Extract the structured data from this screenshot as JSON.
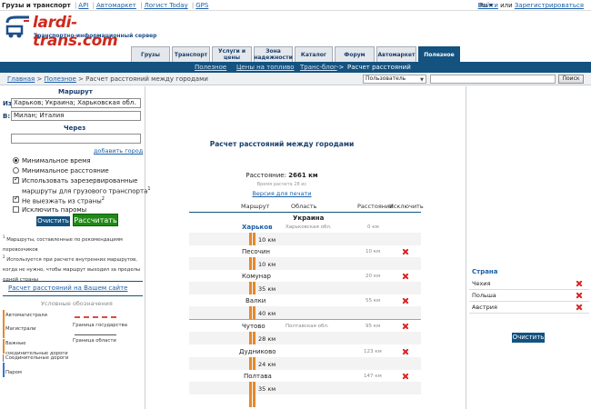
{
  "topbar": {
    "site_name": "Грузы и транспорт",
    "links": [
      "API",
      "Автомаркет",
      "Логист Today",
      "GPS"
    ],
    "lang": "Ru",
    "login": "Войти",
    "or": "или",
    "register": "Зарегистрироваться"
  },
  "logo": {
    "name": "lardi-trans.com",
    "tagline": "Транспортно-информационный сервер"
  },
  "tabs": [
    "Грузы",
    "Транспорт",
    "Услуги и цены",
    "Зона надежности",
    "Каталог",
    "Форум",
    "Автомаркет",
    "Полезное"
  ],
  "subnav": {
    "items": [
      "Полезное",
      "Цены на топливо",
      "Транс-блог"
    ],
    "arrow": "->",
    "current": "Расчет расстояний"
  },
  "breadcrumb": {
    "items": [
      "Главная",
      "Полезное"
    ],
    "separator": ">",
    "current": "Расчет расстояний между городами"
  },
  "user_select": {
    "value": "Пользователь"
  },
  "search": {
    "button": "Поиск"
  },
  "form": {
    "title": "Маршрут",
    "from_label": "Из:",
    "from_value": "Харьков; Украина; Харьковская обл.",
    "to_label": "В:",
    "to_value": "Милан; Италия",
    "via_label": "Через",
    "via_value": "",
    "add_city": "добавить город",
    "options": {
      "min_time": "Минимальное время",
      "min_distance": "Минимальное расстояние",
      "reserved_routes_1": "Использовать зарезервированные",
      "reserved_routes_2": "маршруты для грузового транспорта",
      "reserved_sup": "1",
      "no_leave_country": "Не выезжать из страны",
      "no_leave_sup": "2",
      "exclude_ferries": "Исключить паромы"
    },
    "selected_mode": "min_time",
    "checks": {
      "reserved": true,
      "no_leave": true,
      "ferries": false
    },
    "clear_button": "Очистить",
    "calc_button": "Рассчитать"
  },
  "notes": {
    "n1_sup": "1",
    "n1": "Маршруты, составленные по рекомендациям перевозчиков",
    "n2_sup": "2",
    "n2": "Используется при расчете внутренних маршрутов, когда не нужно, чтобы маршрут выходил за пределы одной страны",
    "site_link": "Расчет расстояний на Вашем сайте"
  },
  "legend": {
    "title": "Условные обозначения",
    "items": [
      "Автомагистрали",
      "Магистрали",
      "Важные соединительные дороги",
      "Соединительные дороги",
      "Паром"
    ],
    "state_border": "Граница государства",
    "region_border": "Граница области",
    "colors": {
      "motorway": "#e58a2b",
      "trunk": "#e58a2b",
      "important": "#e58a2b",
      "connecting": "#777777",
      "ferry": "#3b78c4"
    }
  },
  "result": {
    "title": "Расчет расстояний между городами",
    "distance_label": "Расстояние:",
    "distance_value": "2661 км",
    "calc_time": "Время расчета 28 ис",
    "print_link": "Версия для печати",
    "columns": [
      "Маршрут",
      "Область",
      "Расстояние",
      "Исключить"
    ],
    "country": "Украина",
    "stops": [
      {
        "city": "Харьков",
        "region": "Харьковская обл.",
        "dist": "0 км",
        "leg": "10 км",
        "removable": false
      },
      {
        "city": "Песочин",
        "region": "",
        "dist": "10 км",
        "leg": "10 км",
        "removable": true
      },
      {
        "city": "Комунар",
        "region": "",
        "dist": "20 км",
        "leg": "35 км",
        "removable": true
      },
      {
        "city": "Валки",
        "region": "",
        "dist": "55 км",
        "leg": "40 км",
        "removable": true
      },
      {
        "city": "Чутово",
        "region": "Полтавская обл.",
        "dist": "95 км",
        "leg": "28 км",
        "removable": true
      },
      {
        "city": "Дудниково",
        "region": "",
        "dist": "123 км",
        "leg": "24 км",
        "removable": true
      },
      {
        "city": "Полтава",
        "region": "",
        "dist": "147 км",
        "leg": "35 км",
        "removable": true
      }
    ]
  },
  "countries_panel": {
    "title": "Страна",
    "items": [
      "Чехия",
      "Польша",
      "Австрия"
    ],
    "clear_button": "Очистить"
  }
}
